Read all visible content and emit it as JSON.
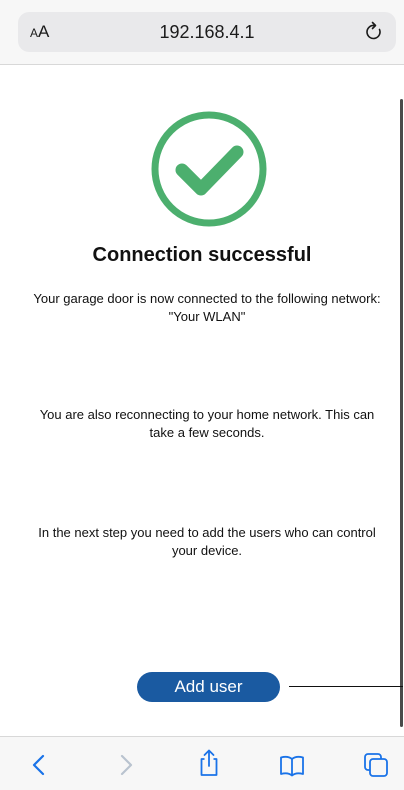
{
  "browser": {
    "reader_label_small": "A",
    "reader_label_large": "A",
    "url": "192.168.4.1"
  },
  "page": {
    "title": "Connection successful",
    "message_connected": "Your garage door is now connected to the following network: \"Your WLAN\"",
    "message_reconnecting": "You are also reconnecting to your home network. This can take a few seconds.",
    "message_next_step": "In the next step you need to add the users who can control your device.",
    "add_user_label": "Add user"
  },
  "icons": {
    "success": "checkmark-circle-icon",
    "reload": "reload-icon",
    "back": "chevron-left-icon",
    "forward": "chevron-right-icon",
    "share": "share-icon",
    "bookmarks": "book-icon",
    "tabs": "tabs-icon"
  },
  "colors": {
    "success_green": "#4caf6e",
    "button_blue": "#1a5aa1",
    "toolbar_blue": "#1a73e8",
    "toolbar_disabled": "#b9c3cf"
  }
}
